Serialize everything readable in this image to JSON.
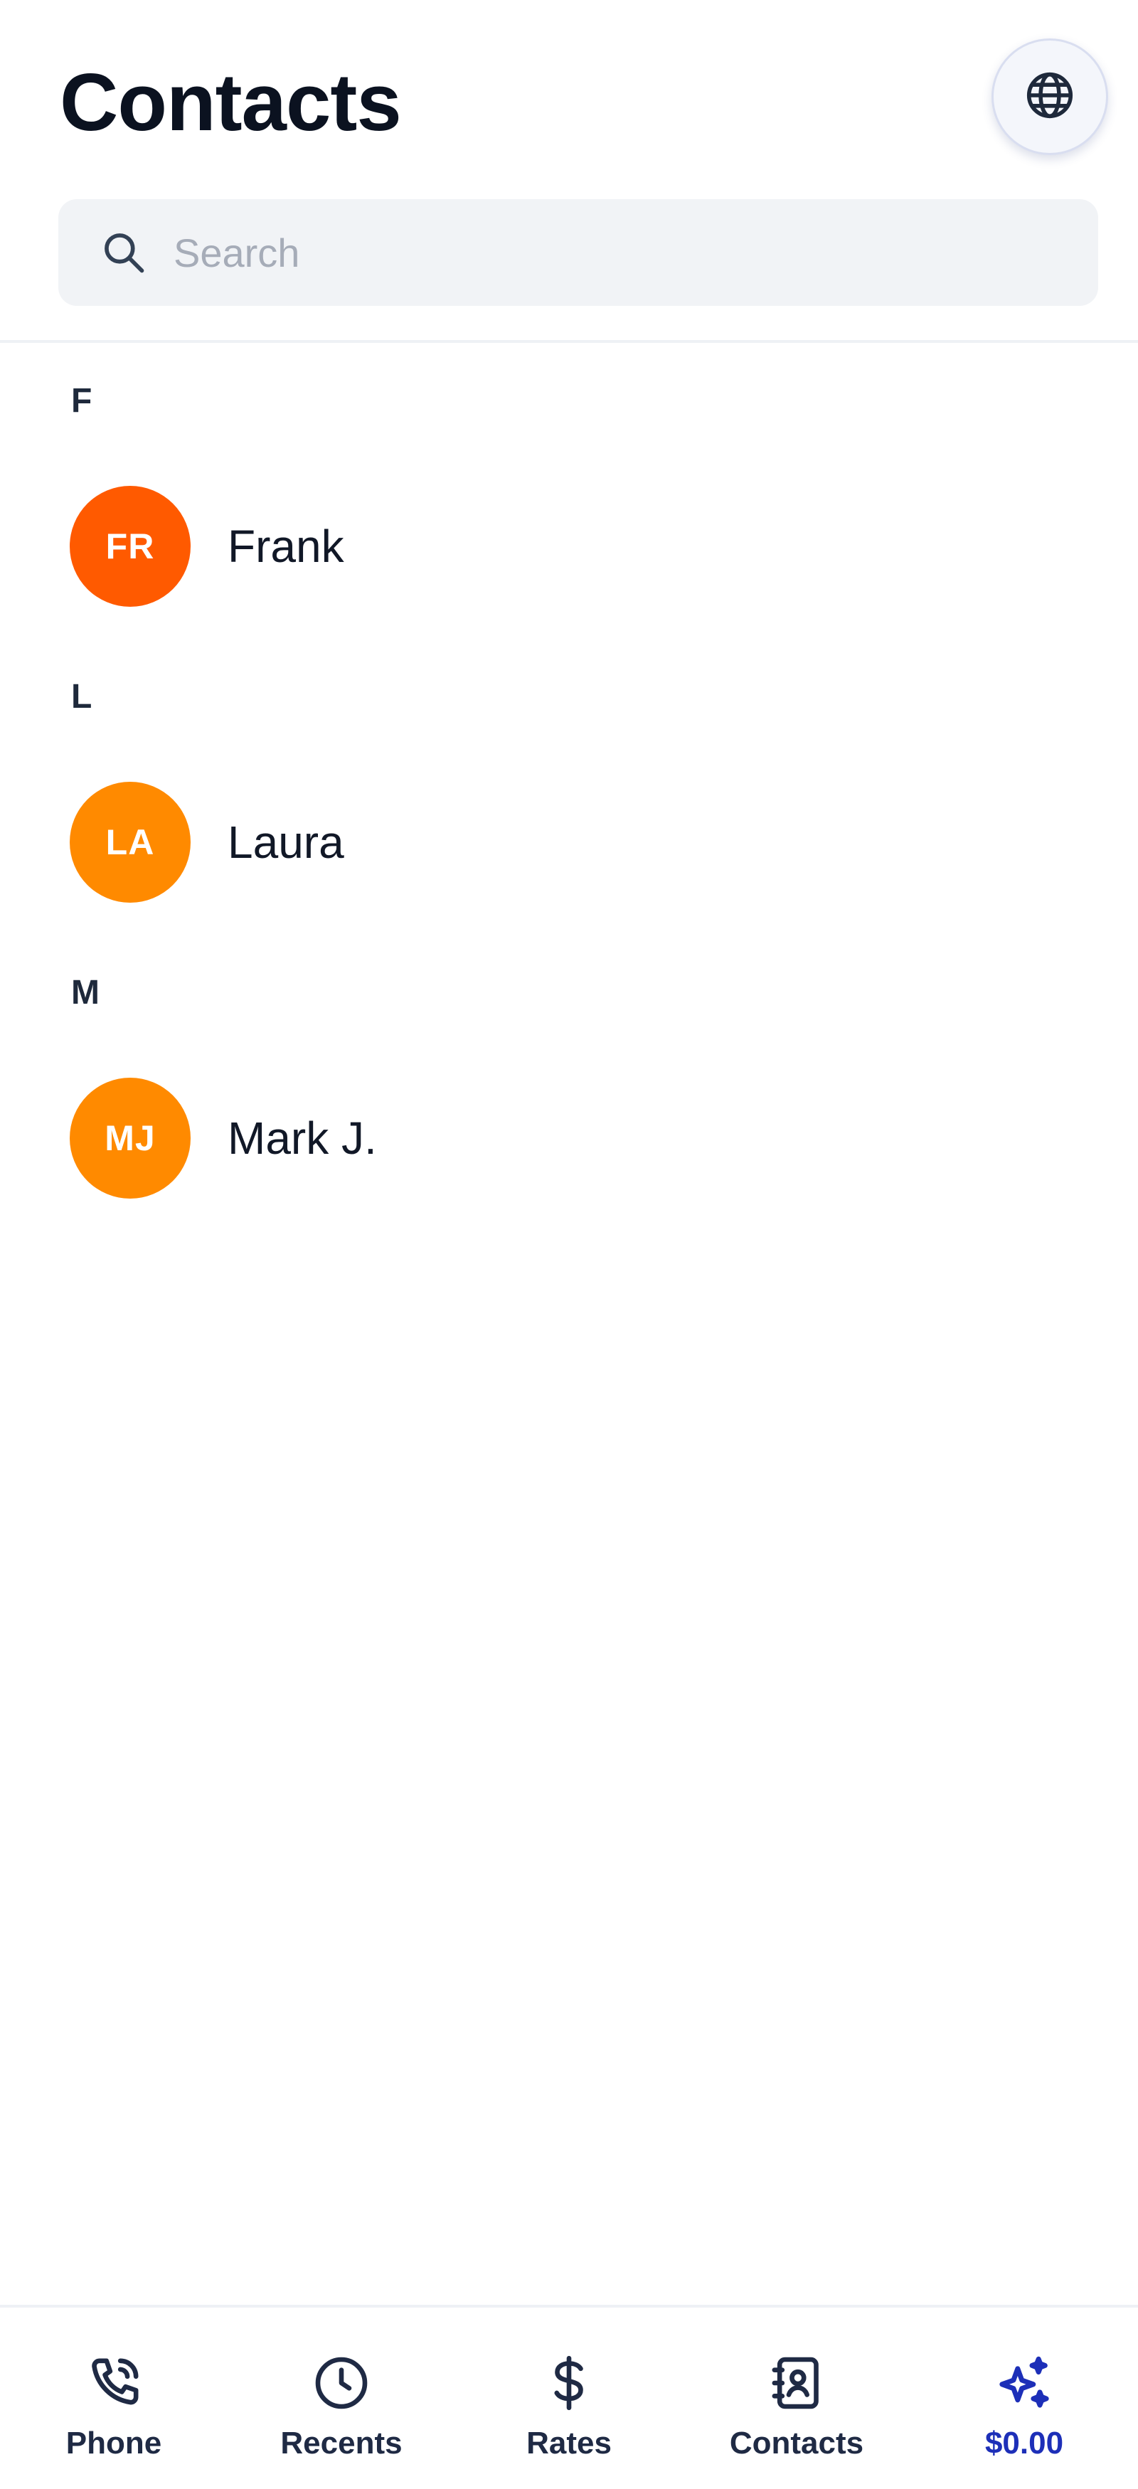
{
  "header": {
    "title": "Contacts",
    "globe_icon": "globe-icon"
  },
  "search": {
    "placeholder": "Search",
    "value": "",
    "icon": "search-icon"
  },
  "sections": [
    {
      "letter": "F",
      "contacts": [
        {
          "initials": "FR",
          "name": "Frank",
          "avatar_color": "#ff5a00"
        }
      ]
    },
    {
      "letter": "L",
      "contacts": [
        {
          "initials": "LA",
          "name": "Laura",
          "avatar_color": "#ff8a00"
        }
      ]
    },
    {
      "letter": "M",
      "contacts": [
        {
          "initials": "MJ",
          "name": "Mark J.",
          "avatar_color": "#ff8a00"
        }
      ]
    }
  ],
  "bottom_nav": {
    "items": [
      {
        "label": "Phone",
        "icon": "phone-icon",
        "active": false
      },
      {
        "label": "Recents",
        "icon": "clock-icon",
        "active": false
      },
      {
        "label": "Rates",
        "icon": "dollar-icon",
        "active": false
      },
      {
        "label": "Contacts",
        "icon": "contacts-book-icon",
        "active": false
      },
      {
        "label": "$0.00",
        "icon": "sparkles-icon",
        "active": true
      }
    ]
  },
  "colors": {
    "accent": "#1d2fb8",
    "text": "#0f172a",
    "search_bg": "#f1f3f6"
  }
}
